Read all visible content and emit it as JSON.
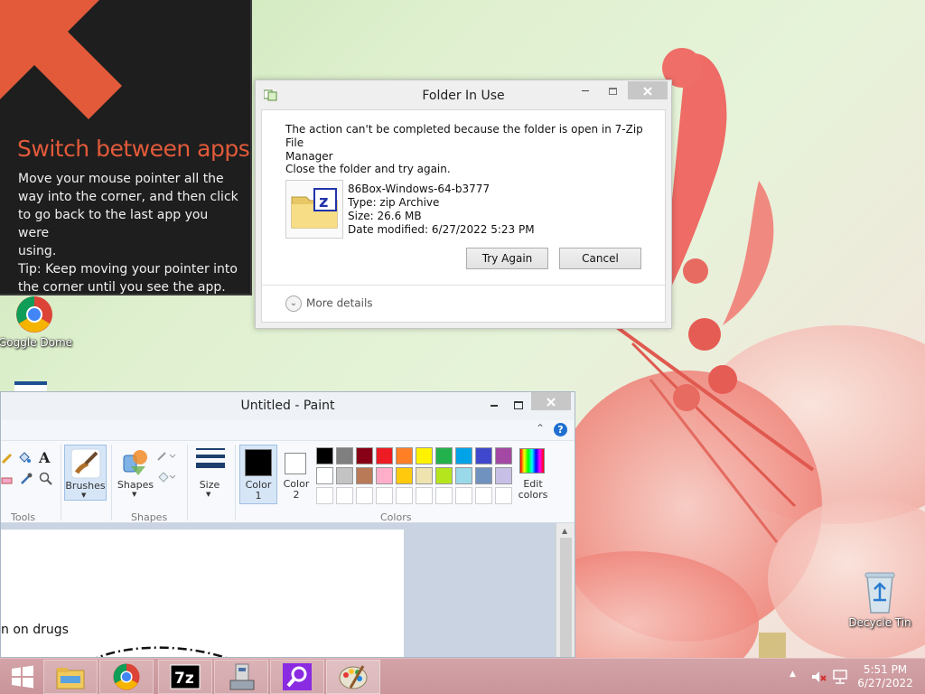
{
  "tip": {
    "title": "Switch between apps",
    "body_lines": [
      "Move your mouse pointer all the",
      "way into the corner, and then click",
      "to go back to the last app you were",
      "using.",
      "Tip: Keep moving your pointer into",
      "the corner until you see the app."
    ]
  },
  "desktop_icons": {
    "chrome": "Goggle Dome",
    "recycle": "Decycle Tin"
  },
  "dialog": {
    "title": "Folder In Use",
    "message_lines": [
      "The action can't be completed because the folder is open in 7-Zip File",
      "Manager"
    ],
    "instruction": "Close the folder and try again.",
    "file_name": "86Box-Windows-64-b3777",
    "file_type": "Type: zip Archive",
    "file_size": "Size: 26.6 MB",
    "file_date": "Date modified: 6/27/2022 5:23 PM",
    "try_again": "Try Again",
    "cancel": "Cancel",
    "more_details": "More details"
  },
  "paint": {
    "title": "Untitled - Paint",
    "help": "?",
    "ribbon": {
      "brushes": "Brushes",
      "shapes": "Shapes",
      "size": "Size",
      "color1_line1": "Color",
      "color1_line2": "1",
      "color2_line1": "Color",
      "color2_line2": "2",
      "edit_colors_line1": "Edit",
      "edit_colors_line2": "colors",
      "group_tools": "Tools",
      "group_shapes": "Shapes",
      "group_colors": "Colors",
      "text_tool": "A"
    },
    "palette_row1": [
      "#000000",
      "#7f7f7f",
      "#880015",
      "#ed1c24",
      "#ff7f27",
      "#fff200",
      "#22b14c",
      "#00a2e8",
      "#3f48cc",
      "#a349a4"
    ],
    "palette_row2": [
      "#ffffff",
      "#c3c3c3",
      "#b97a57",
      "#ffaec9",
      "#ffc90e",
      "#efe4b0",
      "#b5e61d",
      "#99d9ea",
      "#7092be",
      "#c8bfe7"
    ],
    "canvas_text": "n on drugs"
  },
  "clock": {
    "time": "5:51 PM",
    "date": "6/27/2022"
  },
  "taskbar_icons": [
    "windows-start-icon",
    "file-explorer-icon",
    "chrome-icon",
    "7zip-icon",
    "installer-icon",
    "magnifier-icon",
    "paint-icon"
  ]
}
